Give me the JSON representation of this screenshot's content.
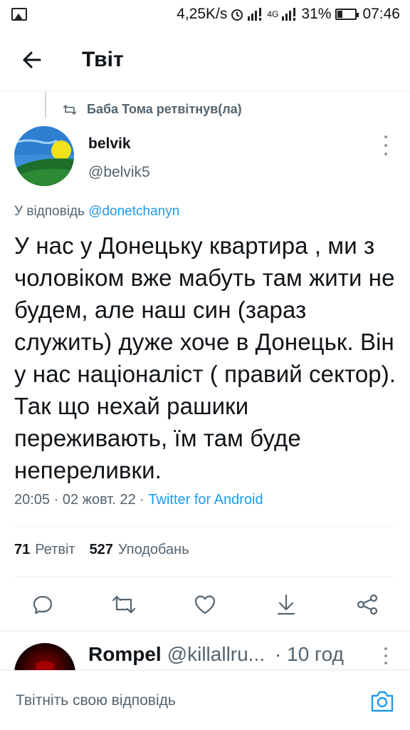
{
  "status_bar": {
    "speed": "4,25K/s",
    "network": "4G",
    "battery": "31%",
    "time": "07:46"
  },
  "header": {
    "title": "Твіт"
  },
  "retweet_context": {
    "text": "Баба Тома ретвітнув(ла)"
  },
  "tweet": {
    "author_name": "belvik",
    "author_handle": "@belvik5",
    "reply_prefix": "У відповідь",
    "reply_to": "@donetchanyn",
    "text": "У нас у Донецьку квартира , ми з чоловіком вже мабуть там жити не будем, але наш син (зараз служить) дуже хоче в Донецьк. Він у нас націоналіст ( правий сектор). Так що нехай рашики  переживають, їм там буде непереливки.",
    "timestamp": "20:05 · 02 жовт. 22 ·",
    "source": "Twitter for Android",
    "retweets_count": "71",
    "retweets_label": "Ретвіт",
    "likes_count": "527",
    "likes_label": "Уподобань"
  },
  "actions": [
    "reply-icon",
    "retweet-icon",
    "like-icon",
    "download-icon",
    "share-icon"
  ],
  "next_tweet": {
    "author_name": "Rompel",
    "author_handle": "@killallru...",
    "time": "· 10 год"
  },
  "compose": {
    "placeholder": "Твітніть свою відповідь"
  },
  "colors": {
    "accent": "#1d9bf0",
    "secondary_text": "#536471",
    "icon": "#536471"
  }
}
